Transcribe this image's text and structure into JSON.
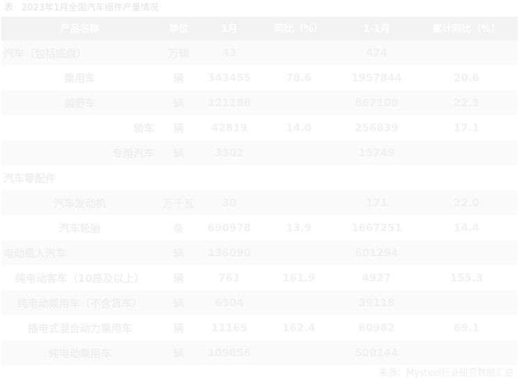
{
  "caption": {
    "prefix": "表",
    "title": "2023年1月全国汽车组件产量情况"
  },
  "table": {
    "headers": [
      "产品名称",
      "单位",
      "1月",
      "同比（%）",
      "1-1月",
      "累计同比（%）"
    ],
    "rows": [
      [
        "汽车（包括底盘）",
        "万辆",
        "43",
        "",
        "474",
        ""
      ],
      [
        "   乘用车",
        "辆",
        "343455",
        "78.6",
        "1957844",
        "20.6"
      ],
      [
        "   越野车",
        "辆",
        "121188",
        "",
        "867108",
        "22.3"
      ],
      [
        "   轿车",
        "辆",
        "42819",
        "14.0",
        "256839",
        "17.1"
      ],
      [
        "   专用汽车",
        "辆",
        "3302",
        "",
        "15749",
        ""
      ],
      [
        "汽车零配件",
        "",
        "",
        "",
        "",
        ""
      ],
      [
        "   汽车发动机",
        "万千瓦",
        "30",
        "",
        "171",
        "22.0"
      ],
      [
        "   汽车轮胎",
        "条",
        "690978",
        "13.9",
        "1667251",
        "14.4"
      ],
      [
        "电动载人汽车",
        "辆",
        "136090",
        "",
        "601294",
        ""
      ],
      [
        "   纯电动客车（10座及以上）",
        "辆",
        "761",
        "161.9",
        "4927",
        "155.3"
      ],
      [
        "   纯电动乘用车（不含货车）",
        "辆",
        "6304",
        "",
        "39118",
        ""
      ],
      [
        "   插电式混合动力乘用车",
        "辆",
        "11165",
        "162.4",
        "60982",
        "69.1"
      ],
      [
        "   纯电动乘用车",
        "辆",
        "109056",
        "",
        "500144",
        ""
      ]
    ]
  },
  "source": {
    "label": "来源：",
    "text": "Mysteel行业研究数据汇总"
  }
}
